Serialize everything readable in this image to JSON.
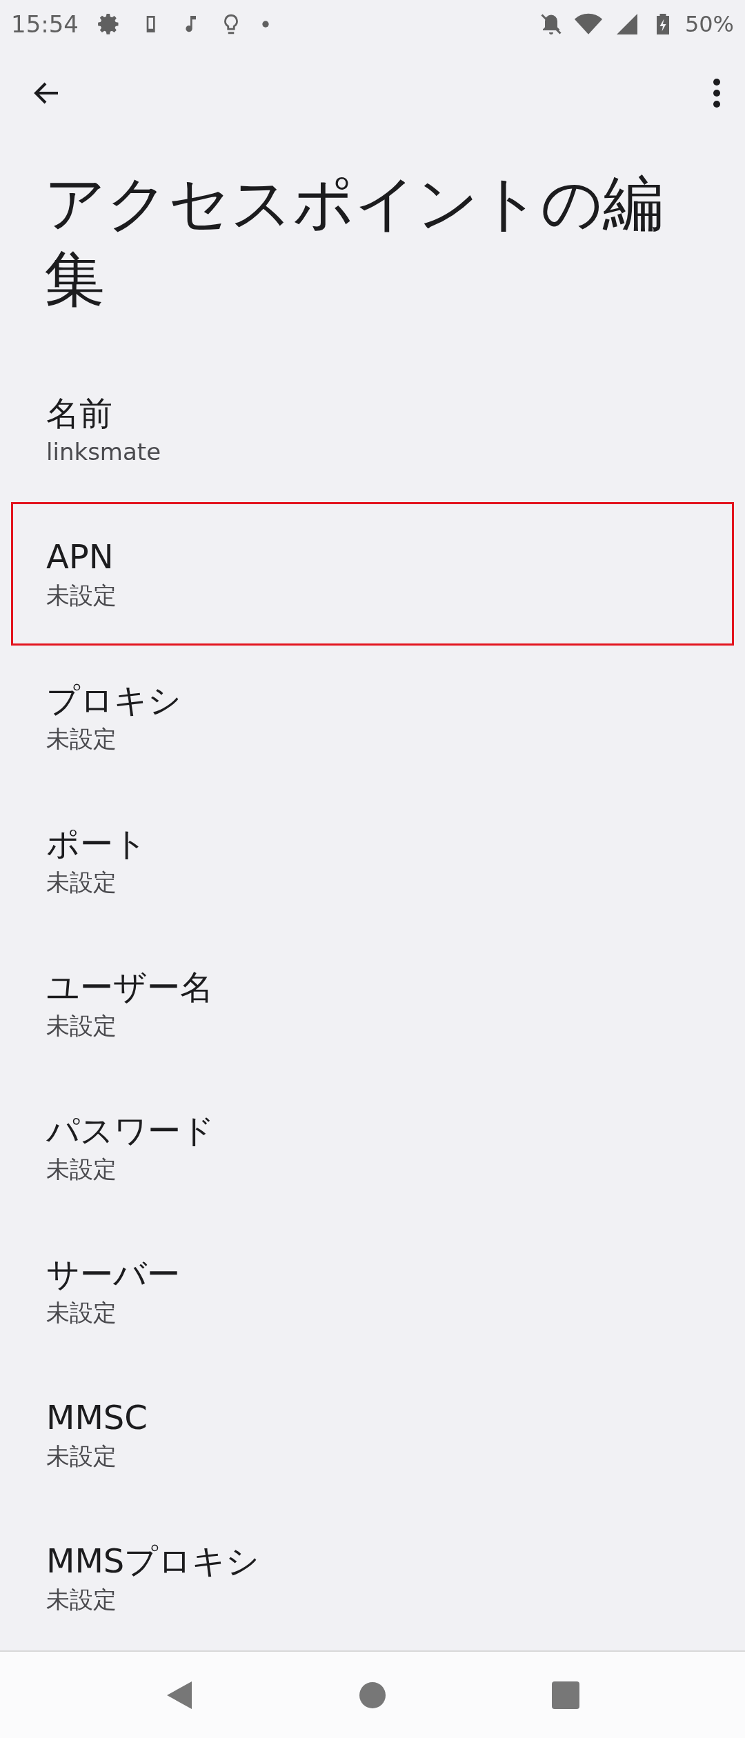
{
  "status_bar": {
    "time": "15:54",
    "battery": "50%"
  },
  "title": "アクセスポイントの編集",
  "items": [
    {
      "title": "名前",
      "value": "linksmate",
      "highlighted": false
    },
    {
      "title": "APN",
      "value": "未設定",
      "highlighted": true
    },
    {
      "title": "プロキシ",
      "value": "未設定",
      "highlighted": false
    },
    {
      "title": "ポート",
      "value": "未設定",
      "highlighted": false
    },
    {
      "title": "ユーザー名",
      "value": "未設定",
      "highlighted": false
    },
    {
      "title": "パスワード",
      "value": "未設定",
      "highlighted": false
    },
    {
      "title": "サーバー",
      "value": "未設定",
      "highlighted": false
    },
    {
      "title": "MMSC",
      "value": "未設定",
      "highlighted": false
    },
    {
      "title": "MMSプロキシ",
      "value": "未設定",
      "highlighted": false
    }
  ]
}
